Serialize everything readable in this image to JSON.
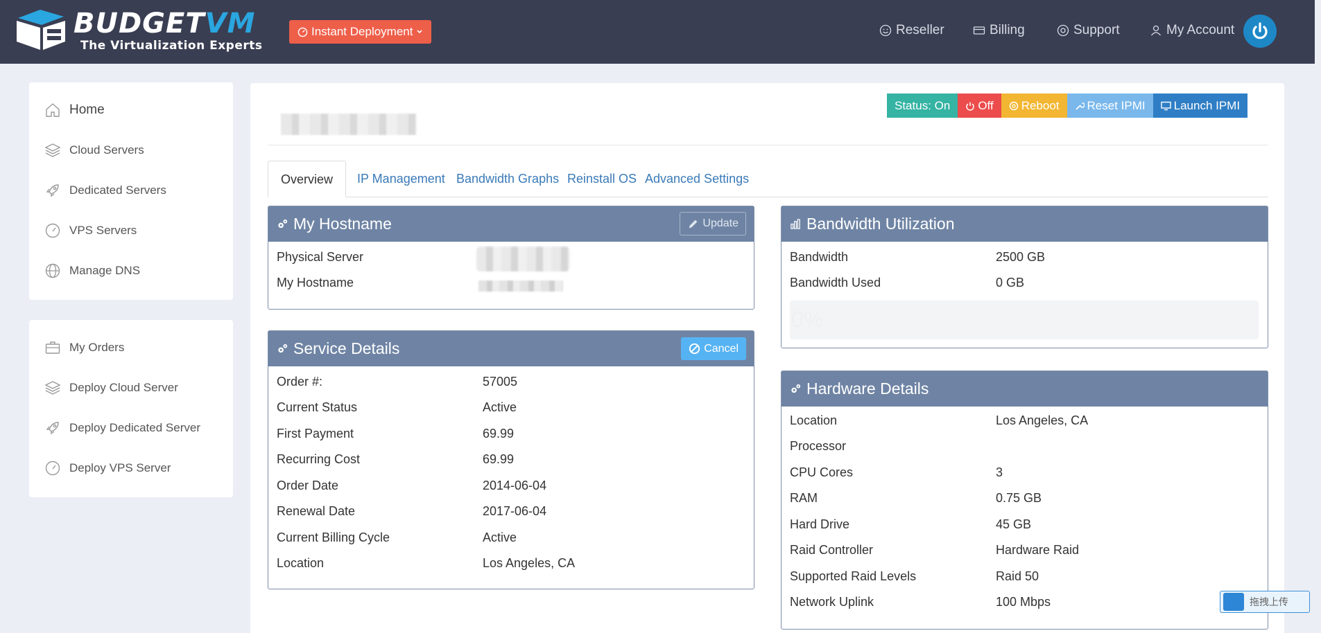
{
  "header": {
    "logo_brand": "BUDGET",
    "logo_brand_accent": "VM",
    "logo_tagline": "The Virtualization Experts",
    "instant_label": "Instant Deployment",
    "nav": {
      "reseller": "Reseller",
      "billing": "Billing",
      "support": "Support",
      "account": "My Account"
    }
  },
  "sidebar": {
    "group1": [
      {
        "label": "Home",
        "icon": "home-icon"
      },
      {
        "label": "Cloud Servers",
        "icon": "layers-icon"
      },
      {
        "label": "Dedicated Servers",
        "icon": "rocket-icon"
      },
      {
        "label": "VPS Servers",
        "icon": "speedometer-icon"
      },
      {
        "label": "Manage DNS",
        "icon": "globe-icon"
      }
    ],
    "group2": [
      {
        "label": "My Orders",
        "icon": "briefcase-icon"
      },
      {
        "label": "Deploy Cloud Server",
        "icon": "layers-icon"
      },
      {
        "label": "Deploy Dedicated Server",
        "icon": "rocket-icon"
      },
      {
        "label": "Deploy VPS Server",
        "icon": "speedometer-icon"
      }
    ]
  },
  "actions": {
    "status": "Status: On",
    "off": "Off",
    "reboot": "Reboot",
    "reset_ipmi": "Reset IPMI",
    "launch_ipmi": "Launch IPMI"
  },
  "tabs": [
    "Overview",
    "IP Management",
    "Bandwidth Graphs",
    "Reinstall OS",
    "Advanced Settings"
  ],
  "hostname_panel": {
    "title": "My Hostname",
    "update_label": "Update",
    "rows": [
      {
        "label": "Physical Server"
      },
      {
        "label": "My Hostname"
      }
    ]
  },
  "service_panel": {
    "title": "Service Details",
    "cancel_label": "Cancel",
    "rows": [
      {
        "label": "Order #:",
        "value": "57005"
      },
      {
        "label": "Current Status",
        "value": "Active"
      },
      {
        "label": "First Payment",
        "value": "69.99"
      },
      {
        "label": "Recurring Cost",
        "value": "69.99"
      },
      {
        "label": "Order Date",
        "value": "2014-06-04"
      },
      {
        "label": "Renewal Date",
        "value": "2017-06-04"
      },
      {
        "label": "Current Billing Cycle",
        "value": "Active"
      },
      {
        "label": "Location",
        "value": "Los Angeles, CA"
      }
    ]
  },
  "bandwidth_panel": {
    "title": "Bandwidth Utilization",
    "rows": [
      {
        "label": "Bandwidth",
        "value": "2500 GB"
      },
      {
        "label": "Bandwidth Used",
        "value": "0 GB"
      }
    ],
    "progress_text": "0%",
    "progress_value": 0
  },
  "hardware_panel": {
    "title": "Hardware Details",
    "rows": [
      {
        "label": "Location",
        "value": "Los Angeles, CA"
      },
      {
        "label": "Processor",
        "value": ""
      },
      {
        "label": "CPU Cores",
        "value": "3"
      },
      {
        "label": "RAM",
        "value": "0.75 GB"
      },
      {
        "label": "Hard Drive",
        "value": "45 GB"
      },
      {
        "label": "Raid Controller",
        "value": "Hardware Raid"
      },
      {
        "label": "Supported Raid Levels",
        "value": "Raid 50"
      },
      {
        "label": "Network Uplink",
        "value": "100 Mbps"
      }
    ]
  },
  "upload_badge": "拖拽上传",
  "colors": {
    "topbar": "#3a3e52",
    "panel_header": "#6f84a4",
    "status_on": "#35b3a3",
    "off": "#ec4c4c",
    "reboot": "#f2b632",
    "reset_ipmi": "#7ab8ec",
    "launch_ipmi": "#2f7ec5",
    "accent_link": "#3a7ab8"
  }
}
